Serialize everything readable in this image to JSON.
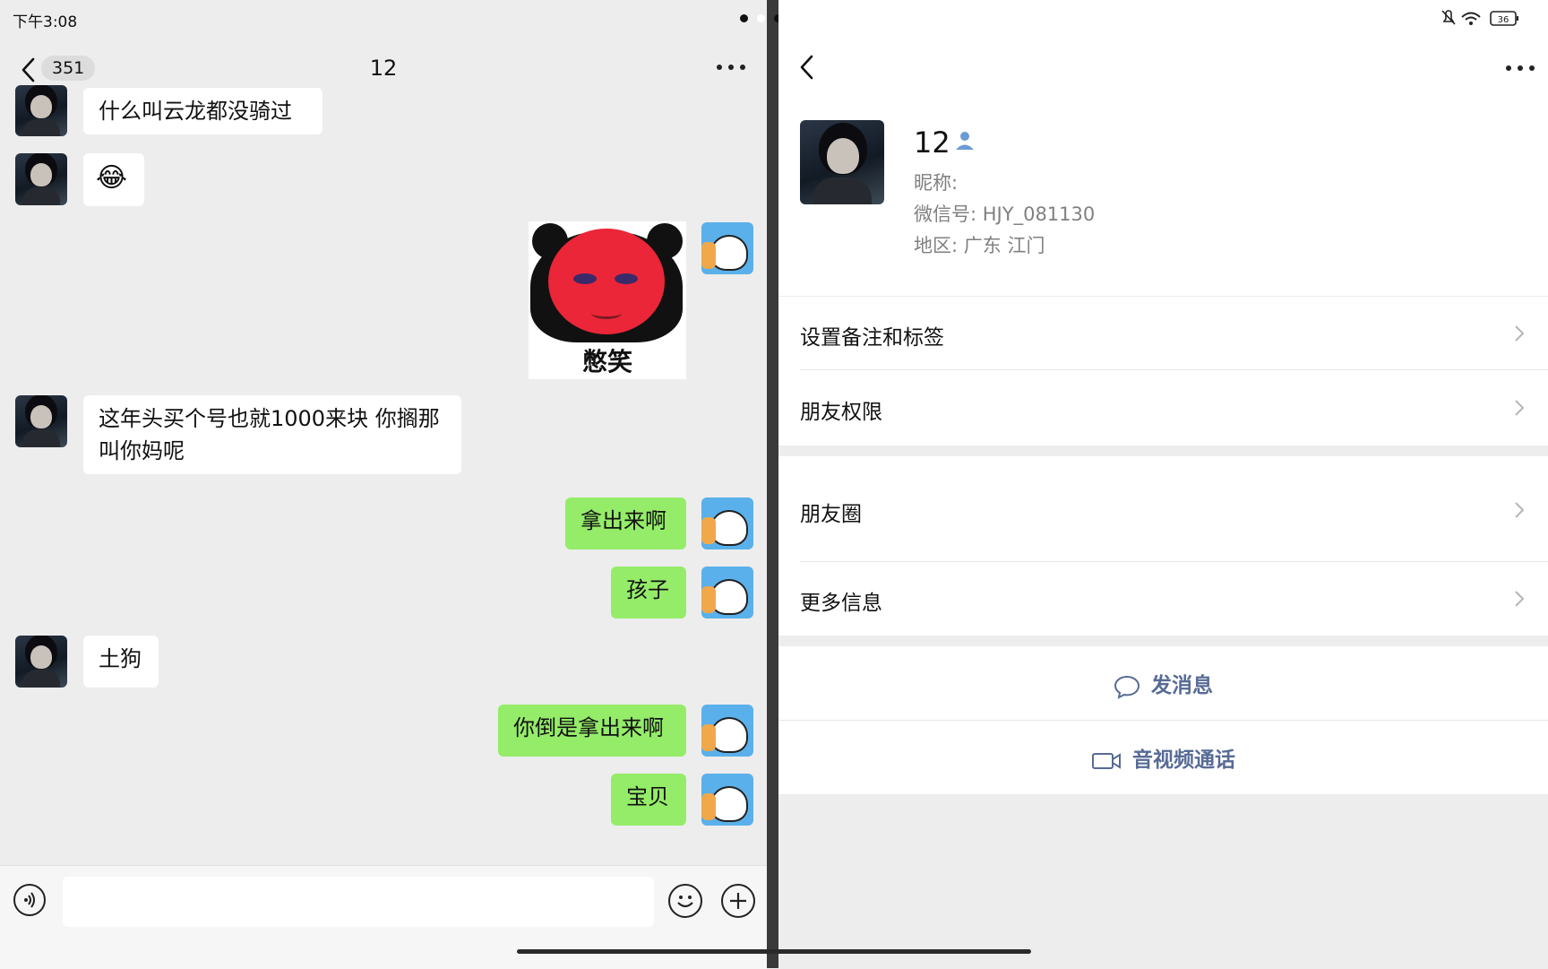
{
  "status": {
    "time": "下午3:08",
    "battery": "36"
  },
  "chat": {
    "unread_count": "351",
    "title": "12",
    "messages": [
      {
        "side": "in",
        "text": "什么叫云龙都没骑过"
      },
      {
        "side": "in",
        "text": "😂"
      },
      {
        "side": "out",
        "type": "sticker",
        "caption": "憋笑"
      },
      {
        "side": "in",
        "text": "这年头买个号也就1000来块 你搁那叫你妈呢"
      },
      {
        "side": "out",
        "text": "拿出来啊"
      },
      {
        "side": "out",
        "text": "孩子"
      },
      {
        "side": "in",
        "text": "土狗"
      },
      {
        "side": "out",
        "text": "你倒是拿出来啊"
      },
      {
        "side": "out",
        "text": "宝贝"
      }
    ],
    "line1": "这年头买个号也就1000来块 你搁那",
    "line2": "叫你妈呢"
  },
  "profile": {
    "name": "12",
    "nickname_label": "昵称:",
    "wechat_id_label": "微信号:",
    "wechat_id": "HJY_081130",
    "region_label": "地区:",
    "region": "广东 江门",
    "menu": [
      {
        "label": "设置备注和标签"
      },
      {
        "label": "朋友权限"
      },
      {
        "label": "朋友圈"
      },
      {
        "label": "更多信息"
      }
    ],
    "actions": {
      "message": "发消息",
      "call": "音视频通话"
    }
  },
  "colors": {
    "outgoing_bubble": "#95ec69",
    "incoming_bubble": "#ffffff",
    "link_blue": "#576b95",
    "background": "#ededed"
  }
}
